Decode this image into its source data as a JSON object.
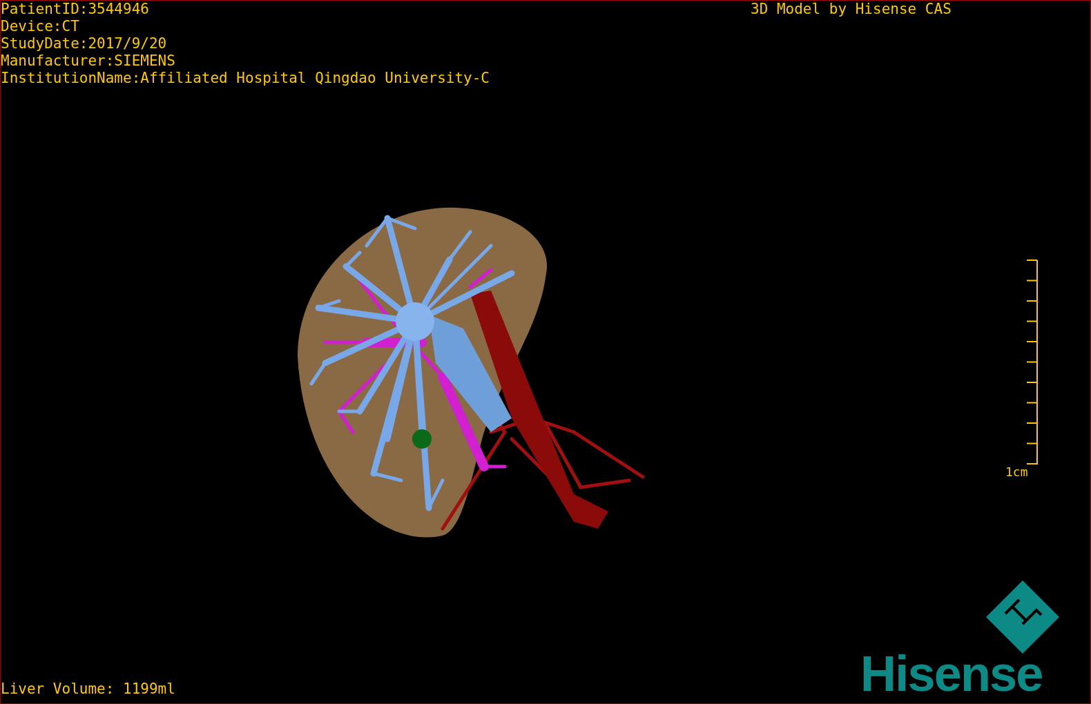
{
  "study_info": [
    "PatientID:3544946",
    "Device:CT",
    "StudyDate:2017/9/20",
    "Manufacturer:SIEMENS",
    "InstitutionName:Affiliated Hospital Qingdao University-C"
  ],
  "model_credit": "3D Model by Hisense CAS",
  "scale_bar": {
    "label": "1cm"
  },
  "liver_volume": "Liver Volume: 1199ml",
  "logo": {
    "wordmark": "Hisense"
  }
}
